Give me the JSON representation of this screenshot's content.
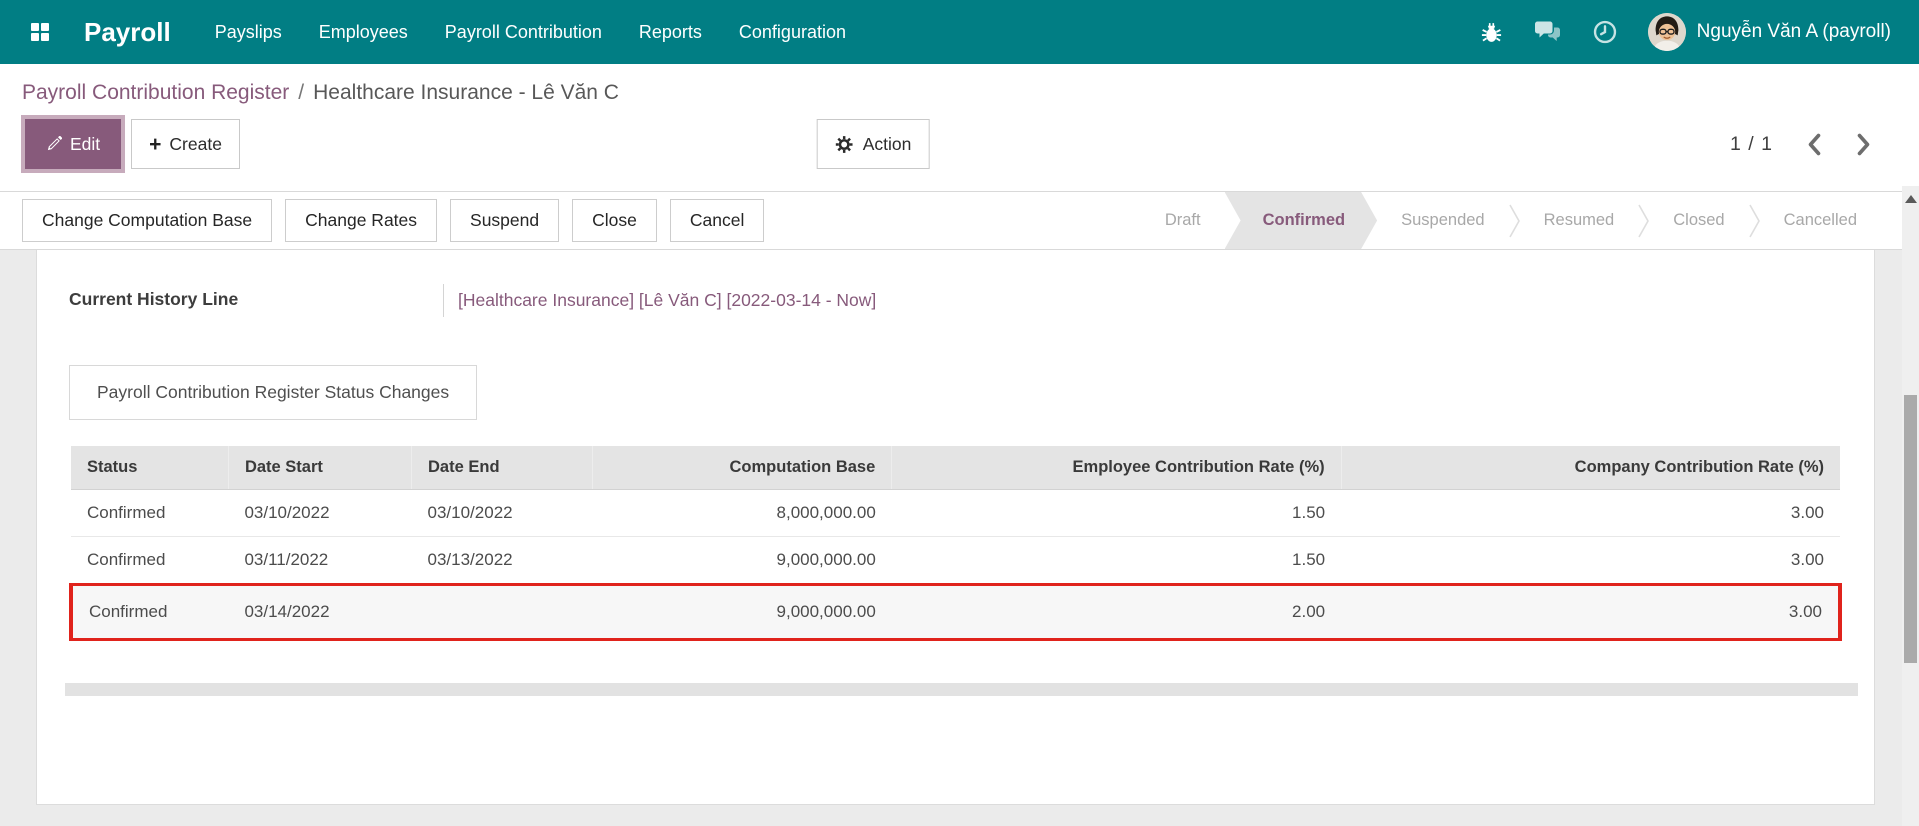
{
  "navbar": {
    "brand": "Payroll",
    "menu": [
      "Payslips",
      "Employees",
      "Payroll Contribution",
      "Reports",
      "Configuration"
    ],
    "user": "Nguyễn Văn A (payroll)"
  },
  "breadcrumb": {
    "parent": "Payroll Contribution Register",
    "separator": "/",
    "current": "Healthcare Insurance - Lê Văn C"
  },
  "actions": {
    "edit": "Edit",
    "create": "Create",
    "action": "Action",
    "pager": "1 / 1"
  },
  "statusbar": {
    "buttons": [
      "Change Computation Base",
      "Change Rates",
      "Suspend",
      "Close",
      "Cancel"
    ],
    "states": [
      "Draft",
      "Confirmed",
      "Suspended",
      "Resumed",
      "Closed",
      "Cancelled"
    ],
    "active_state": "Confirmed"
  },
  "form": {
    "fields": [
      {
        "label": "Current History Line",
        "value": "[Healthcare Insurance] [Lê Văn C] [2022-03-14 - Now]"
      }
    ],
    "tab": "Payroll Contribution Register Status Changes",
    "table": {
      "headers": [
        {
          "label": "Status",
          "align": "left"
        },
        {
          "label": "Date Start",
          "align": "left"
        },
        {
          "label": "Date End",
          "align": "left"
        },
        {
          "label": "Computation Base",
          "align": "right"
        },
        {
          "label": "Employee Contribution Rate (%)",
          "align": "right"
        },
        {
          "label": "Company Contribution Rate (%)",
          "align": "right"
        }
      ],
      "rows": [
        {
          "cells": [
            "Confirmed",
            "03/10/2022",
            "03/10/2022",
            "8,000,000.00",
            "1.50",
            "3.00"
          ],
          "highlighted": false
        },
        {
          "cells": [
            "Confirmed",
            "03/11/2022",
            "03/13/2022",
            "9,000,000.00",
            "1.50",
            "3.00"
          ],
          "highlighted": false
        },
        {
          "cells": [
            "Confirmed",
            "03/14/2022",
            "",
            "9,000,000.00",
            "2.00",
            "3.00"
          ],
          "highlighted": true
        }
      ]
    }
  },
  "colors": {
    "navbar_background": "#017e84",
    "accent_purple": "#875A7B",
    "highlight_red": "#e0231c"
  }
}
